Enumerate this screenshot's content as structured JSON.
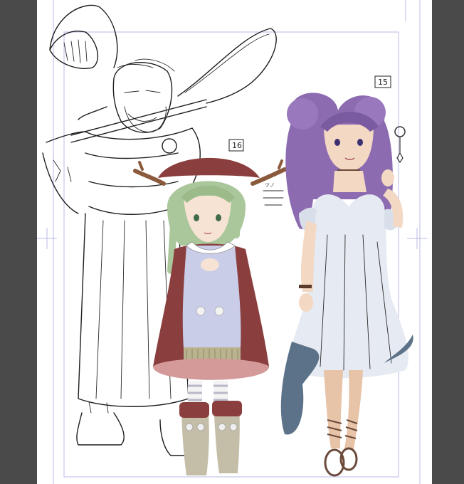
{
  "canvas": {
    "background": "#4a4a4a",
    "page_color": "#ffffff",
    "guide_color": "#b8b8e8"
  },
  "figures": [
    {
      "id": "sketch-old-man",
      "style": "line-sketch",
      "color": "#1e1e1e"
    },
    {
      "id": "green-haired-girl",
      "style": "colored",
      "hair_color": "#a9c79a",
      "coat_color": "#8a3e3e",
      "apron_color": "#c9cde8",
      "label": "16"
    },
    {
      "id": "purple-haired-woman",
      "style": "colored",
      "hair_color": "#8c6bb0",
      "dress_color": "#e6eaf2",
      "skin_color": "#f3d8c4",
      "label": "15"
    }
  ],
  "labels": {
    "girl_number": "16",
    "woman_number": "15",
    "side_note": "ツノ"
  }
}
